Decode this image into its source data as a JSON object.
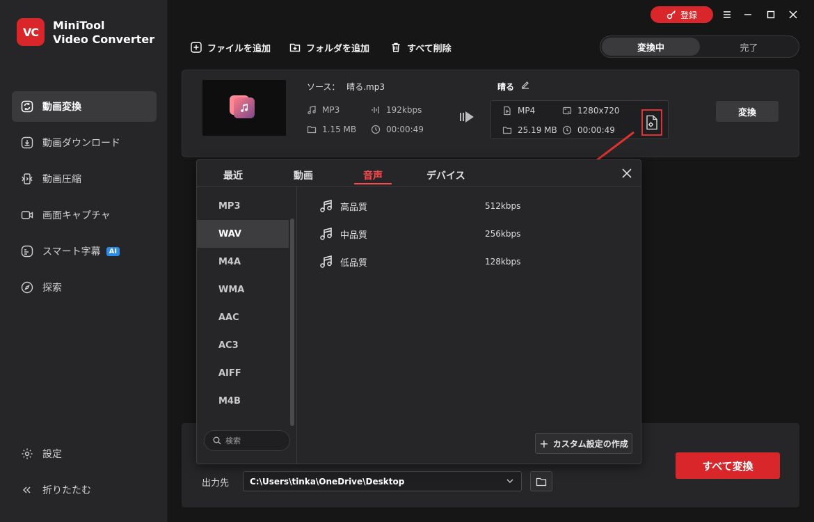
{
  "app": {
    "logo_text": "VC",
    "name_line1": "MiniTool",
    "name_line2": "Video Converter",
    "accent": "#d8262b"
  },
  "sidebar": {
    "items": [
      {
        "label": "動画変換",
        "icon": "convert-icon",
        "active": true
      },
      {
        "label": "動画ダウンロード",
        "icon": "download-icon"
      },
      {
        "label": "動画圧縮",
        "icon": "compress-icon"
      },
      {
        "label": "画面キャプチャ",
        "icon": "camera-icon"
      },
      {
        "label": "スマート字幕",
        "icon": "subtitle-icon",
        "badge": "AI"
      },
      {
        "label": "探索",
        "icon": "compass-icon"
      }
    ],
    "settings_label": "設定",
    "collapse_label": "折りたたむ"
  },
  "window": {
    "login_label": "登録"
  },
  "toolbar": {
    "add_file": "ファイルを追加",
    "add_folder": "フォルダを追加",
    "delete_all": "すべて削除",
    "tab_converting": "変換中",
    "tab_done": "完了"
  },
  "file": {
    "source_label": "ソース：",
    "source_name": "晴る.mp3",
    "source_format": "MP3",
    "source_bitrate": "192kbps",
    "source_size": "1.15 MB",
    "source_duration": "00:00:49",
    "target_name": "晴る",
    "target_format": "MP4",
    "target_resolution": "1280x720",
    "target_size": "25.19 MB",
    "target_duration": "00:00:49",
    "convert_label": "変換"
  },
  "popup": {
    "tabs": [
      "最近",
      "動画",
      "音声",
      "デバイス"
    ],
    "active_tab": "音声",
    "formats": [
      "MP3",
      "WAV",
      "M4A",
      "WMA",
      "AAC",
      "AC3",
      "AIFF",
      "M4B"
    ],
    "active_format": "WAV",
    "search_placeholder": "検索",
    "presets": [
      {
        "label": "高品質",
        "rate": "512kbps"
      },
      {
        "label": "中品質",
        "rate": "256kbps"
      },
      {
        "label": "低品質",
        "rate": "128kbps"
      }
    ],
    "custom_label": "カスタム設定の作成"
  },
  "output": {
    "label": "出力先",
    "path": "C:\\Users\\tinka\\OneDrive\\Desktop",
    "convert_all": "すべて変換"
  }
}
